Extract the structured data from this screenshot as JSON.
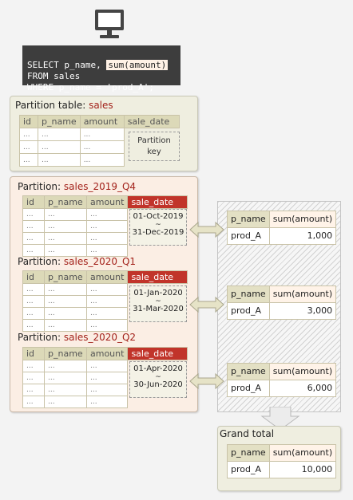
{
  "monitor_icon": "monitor-icon",
  "sql": {
    "line1_pre": "SELECT p_name, ",
    "line1_hl": "sum(amount)",
    "line2": "FROM sales",
    "line3": "WHERE p_name = 'prod_A';"
  },
  "partition_table": {
    "label": "Partition table: ",
    "name": "sales",
    "columns": [
      "id",
      "p_name",
      "amount",
      "sale_date"
    ],
    "rows": [
      [
        "...",
        "...",
        "..."
      ],
      [
        "...",
        "...",
        "..."
      ],
      [
        "...",
        "...",
        "..."
      ]
    ],
    "key_line1": "Partition",
    "key_line2": "key"
  },
  "partitions": [
    {
      "label": "Partition: ",
      "name": "sales_2019_Q4",
      "columns": [
        "id",
        "p_name",
        "amount",
        "sale_date"
      ],
      "from": "01-Oct-2019",
      "tilde": "~",
      "to": "31-Dec-2019"
    },
    {
      "label": "Partition: ",
      "name": "sales_2020_Q1",
      "columns": [
        "id",
        "p_name",
        "amount",
        "sale_date"
      ],
      "from": "01-Jan-2020",
      "tilde": "~",
      "to": "31-Mar-2020"
    },
    {
      "label": "Partition: ",
      "name": "sales_2020_Q2",
      "columns": [
        "id",
        "p_name",
        "amount",
        "sale_date"
      ],
      "from": "01-Apr-2020",
      "tilde": "~",
      "to": "30-Jun-2020"
    }
  ],
  "partition_rows": [
    "...",
    "...",
    "...",
    "..."
  ],
  "results": [
    {
      "col1": "p_name",
      "col2": "sum(amount)",
      "p": "prod_A",
      "v": "1,000"
    },
    {
      "col1": "p_name",
      "col2": "sum(amount)",
      "p": "prod_A",
      "v": "3,000"
    },
    {
      "col1": "p_name",
      "col2": "sum(amount)",
      "p": "prod_A",
      "v": "6,000"
    }
  ],
  "grand_total": {
    "label": "Grand total",
    "col1": "p_name",
    "col2": "sum(amount)",
    "p": "prod_A",
    "v": "10,000"
  },
  "colors": {
    "accent_red": "#c1342a",
    "header_beige": "#dcd9b8",
    "panel_beige": "#efeee0",
    "panel_pink": "#fbeee4"
  }
}
